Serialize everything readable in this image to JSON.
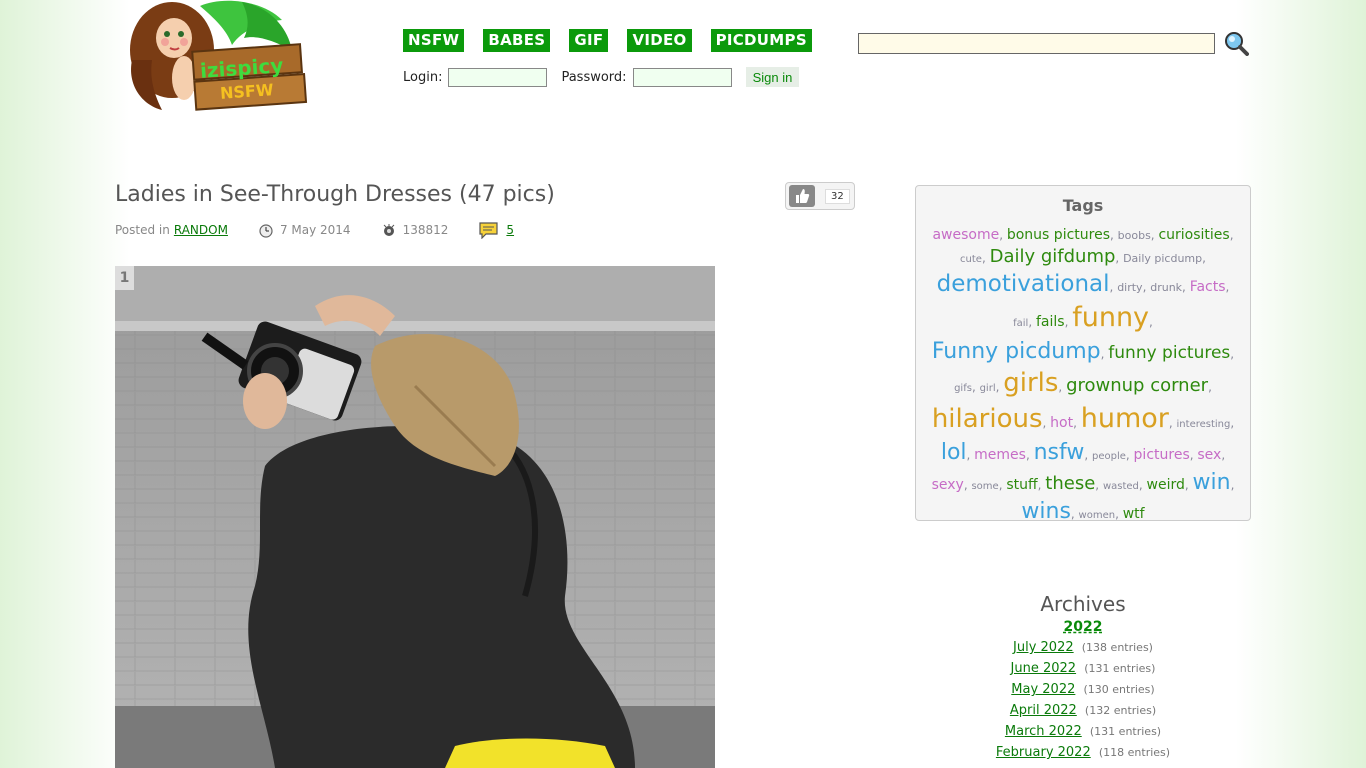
{
  "site": {
    "logo_text_top": "izispicy",
    "logo_text_bottom": "NSFW"
  },
  "nav": [
    "NSFW",
    "BABES",
    "GIF",
    "VIDEO",
    "PICDUMPS"
  ],
  "login": {
    "login_label": "Login:",
    "password_label": "Password:",
    "signin_label": "Sign in"
  },
  "post": {
    "title": "Ladies in See-Through Dresses (47 pics)",
    "posted_in_label": "Posted in",
    "category": "RANDOM",
    "date": "7 May 2014",
    "views": "138812",
    "comments": "5",
    "likes": "32",
    "photo_number": "1"
  },
  "tags": {
    "title": "Tags",
    "items": [
      {
        "label": "awesome",
        "color": "purple",
        "size": 14
      },
      {
        "label": "bonus pictures",
        "color": "green",
        "size": 14
      },
      {
        "label": "boobs",
        "color": "gray",
        "size": 11
      },
      {
        "label": "curiosities",
        "color": "green",
        "size": 14
      },
      {
        "label": "cute",
        "color": "gray",
        "size": 10
      },
      {
        "label": "Daily gifdump",
        "color": "green",
        "size": 18
      },
      {
        "label": "Daily picdump",
        "color": "gray",
        "size": 11
      },
      {
        "label": "demotivational",
        "color": "blue",
        "size": 23
      },
      {
        "label": "dirty",
        "color": "gray",
        "size": 11
      },
      {
        "label": "drunk",
        "color": "gray",
        "size": 11
      },
      {
        "label": "Facts",
        "color": "purple",
        "size": 14
      },
      {
        "label": "fail",
        "color": "gray",
        "size": 10
      },
      {
        "label": "fails",
        "color": "green",
        "size": 14
      },
      {
        "label": "funny",
        "color": "orange",
        "size": 27
      },
      {
        "label": "Funny picdump",
        "color": "blue",
        "size": 22
      },
      {
        "label": "funny pictures",
        "color": "green",
        "size": 17
      },
      {
        "label": "gifs",
        "color": "gray",
        "size": 10
      },
      {
        "label": "girl",
        "color": "gray",
        "size": 10
      },
      {
        "label": "girls",
        "color": "orange",
        "size": 26
      },
      {
        "label": "grownup corner",
        "color": "green",
        "size": 18
      },
      {
        "label": "hilarious",
        "color": "orange",
        "size": 26
      },
      {
        "label": "hot",
        "color": "purple",
        "size": 14
      },
      {
        "label": "humor",
        "color": "orange",
        "size": 27
      },
      {
        "label": "interesting",
        "color": "gray",
        "size": 10
      },
      {
        "label": "lol",
        "color": "blue",
        "size": 22
      },
      {
        "label": "memes",
        "color": "purple",
        "size": 14
      },
      {
        "label": "nsfw",
        "color": "blue",
        "size": 22
      },
      {
        "label": "people",
        "color": "gray",
        "size": 10
      },
      {
        "label": "pictures",
        "color": "purple",
        "size": 14
      },
      {
        "label": "sex",
        "color": "purple",
        "size": 14
      },
      {
        "label": "sexy",
        "color": "purple",
        "size": 14
      },
      {
        "label": "some",
        "color": "gray",
        "size": 10
      },
      {
        "label": "stuff",
        "color": "green",
        "size": 14
      },
      {
        "label": "these",
        "color": "green",
        "size": 18
      },
      {
        "label": "wasted",
        "color": "gray",
        "size": 10
      },
      {
        "label": "weird",
        "color": "green",
        "size": 14
      },
      {
        "label": "win",
        "color": "blue",
        "size": 22
      },
      {
        "label": "wins",
        "color": "blue",
        "size": 22
      },
      {
        "label": "women",
        "color": "gray",
        "size": 10
      },
      {
        "label": "wtf",
        "color": "green",
        "size": 14
      }
    ]
  },
  "archives": {
    "title": "Archives",
    "year": "2022",
    "months": [
      {
        "label": "July 2022",
        "count": "(138 entries)"
      },
      {
        "label": "June 2022",
        "count": "(131 entries)"
      },
      {
        "label": "May 2022",
        "count": "(130 entries)"
      },
      {
        "label": "April 2022",
        "count": "(132 entries)"
      },
      {
        "label": "March 2022",
        "count": "(131 entries)"
      },
      {
        "label": "February 2022",
        "count": "(118 entries)"
      }
    ]
  },
  "colors": {
    "nav_green": "#0b9a0b",
    "tag_purple": "#c66cc6",
    "tag_green": "#2e8a0e",
    "tag_blue": "#3aa0dc",
    "tag_orange": "#d9a021"
  }
}
